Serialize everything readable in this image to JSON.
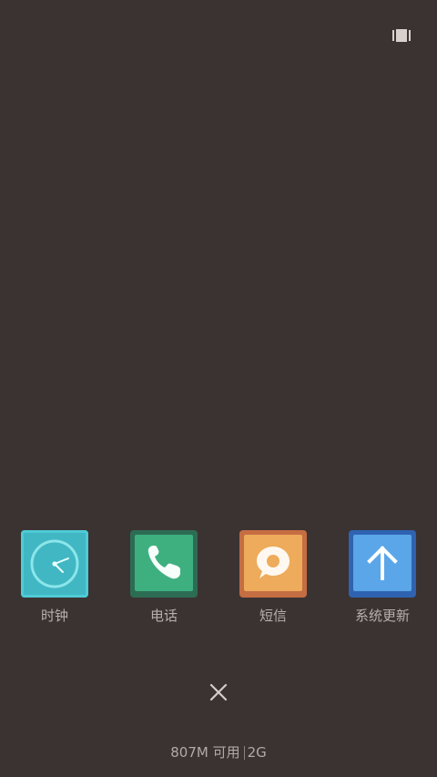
{
  "icons": {
    "top_action": "recent-layout-icon",
    "close": "close-icon"
  },
  "recent_apps": [
    {
      "label": "时钟",
      "icon": "clock-icon",
      "color": "#41b7c4"
    },
    {
      "label": "电话",
      "icon": "phone-icon",
      "color": "#3eb07f"
    },
    {
      "label": "短信",
      "icon": "message-icon",
      "color": "#eeab5b"
    },
    {
      "label": "系统更新",
      "icon": "arrow-up-icon",
      "color": "#5aa6e8"
    }
  ],
  "memory": {
    "available": "807M 可用",
    "total": "2G"
  },
  "colors": {
    "background": "#3b3331",
    "label": "#b7b0ad"
  }
}
